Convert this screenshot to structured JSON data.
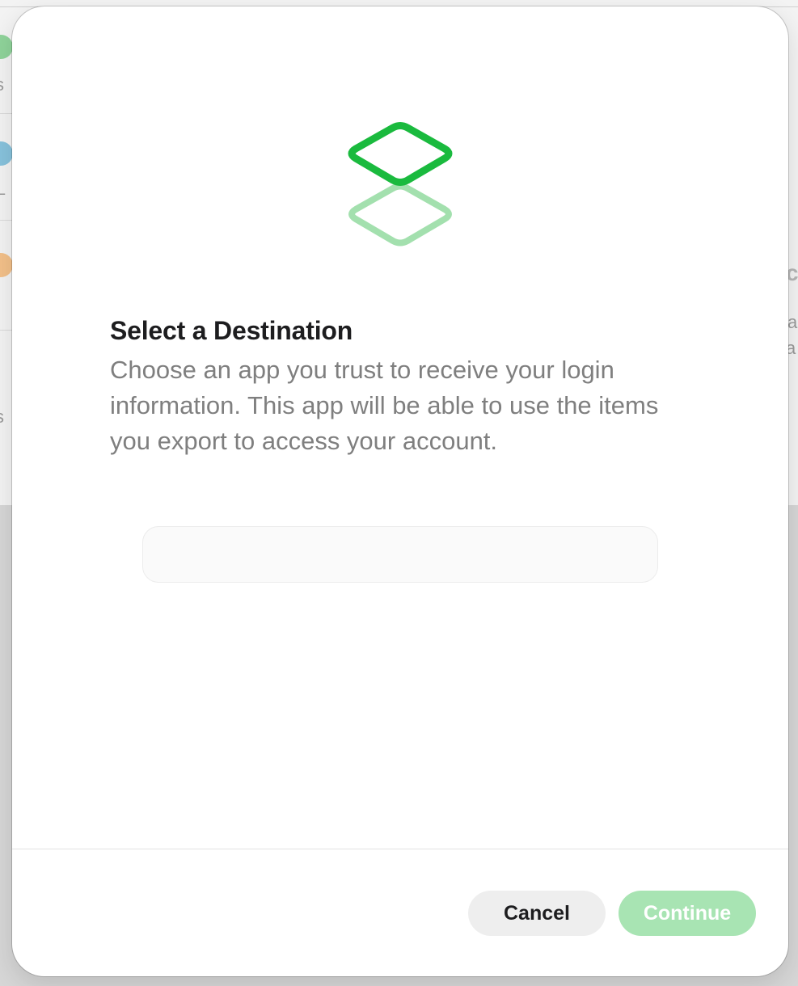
{
  "dialog": {
    "title": "Select a Destination",
    "description": "Choose an app you trust to receive your login information. This app will be able to use the items you export to access your account.",
    "destination_list": []
  },
  "buttons": {
    "cancel_label": "Cancel",
    "continue_label": "Continue"
  },
  "icons": {
    "logo": "stacked-layers-icon"
  },
  "colors": {
    "accent": "#1aba3e",
    "accent_light": "#a3e0ae",
    "continue_disabled": "#a8e4b3"
  }
}
